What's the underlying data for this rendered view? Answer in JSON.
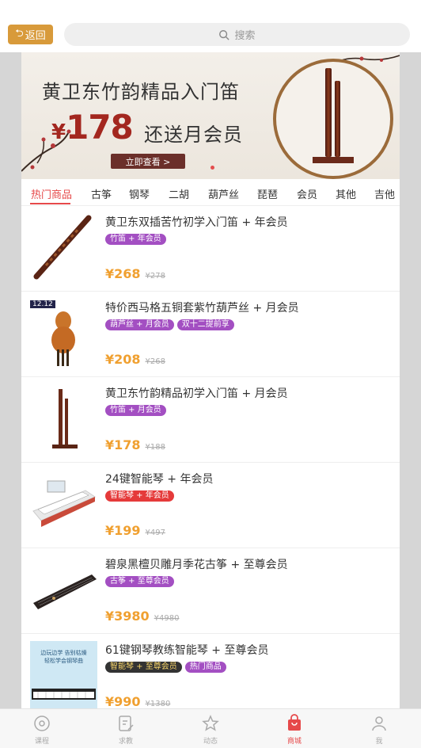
{
  "header": {
    "back_label": "返回",
    "search_placeholder": "搜索"
  },
  "banner": {
    "title": "黄卫东竹韵精品入门笛",
    "price_symbol": "¥",
    "price": "178",
    "subtitle": "还送月会员",
    "cta": "立即查看 >"
  },
  "tabs": [
    "热门商品",
    "古筝",
    "钢琴",
    "二胡",
    "葫芦丝",
    "琵琶",
    "会员",
    "其他",
    "吉他"
  ],
  "active_tab": "热门商品",
  "products": [
    {
      "name": "黄卫东双插苦竹初学入门笛 + 年会员",
      "tags": [
        {
          "text": "竹笛 + 年会员",
          "style": "purple"
        }
      ],
      "price": "¥268",
      "old_price": "¥278",
      "thumb_icon": "flute-icon"
    },
    {
      "name": "特价西马格五铜套紫竹葫芦丝 + 月会员",
      "tags": [
        {
          "text": "葫芦丝 + 月会员",
          "style": "purple"
        },
        {
          "text": "双十二提前享",
          "style": "purple"
        }
      ],
      "price": "¥208",
      "old_price": "¥268",
      "thumb_icon": "hulusi-icon",
      "thumb_badge": "12.12"
    },
    {
      "name": "黄卫东竹韵精品初学入门笛 + 月会员",
      "tags": [
        {
          "text": "竹笛 + 月会员",
          "style": "purple"
        }
      ],
      "price": "¥178",
      "old_price": "¥188",
      "thumb_icon": "flute-stand-icon"
    },
    {
      "name": "24键智能琴 + 年会员",
      "tags": [
        {
          "text": "智能琴 + 年会员",
          "style": "red"
        }
      ],
      "price": "¥199",
      "old_price": "¥497",
      "thumb_icon": "keyboard-icon"
    },
    {
      "name": "碧泉黑檀贝雕月季花古筝 + 至尊会员",
      "tags": [
        {
          "text": "古筝 + 至尊会员",
          "style": "purple"
        }
      ],
      "price": "¥3980",
      "old_price": "¥4980",
      "thumb_icon": "guzheng-icon"
    },
    {
      "name": "61键钢琴教练智能琴 + 至尊会员",
      "tags": [
        {
          "text": "智能琴 + 至尊会员",
          "style": "dark"
        },
        {
          "text": "热门商品",
          "style": "purple"
        }
      ],
      "price": "¥990",
      "old_price": "¥1380",
      "thumb_icon": "piano-61-icon",
      "thumb_caption": "边玩边学 告别枯燥\n轻松学会钢琴曲"
    }
  ],
  "bottom_nav": [
    {
      "label": "课程",
      "icon": "disc-icon"
    },
    {
      "label": "求教",
      "icon": "edit-icon"
    },
    {
      "label": "动态",
      "icon": "star-icon"
    },
    {
      "label": "商城",
      "icon": "bag-icon",
      "active": true
    },
    {
      "label": "我",
      "icon": "user-icon"
    }
  ],
  "colors": {
    "accent": "#e6494a",
    "back_button": "#d89a3a",
    "price": "#f0a030",
    "tag_purple": "#a34fc2",
    "tag_red": "#e53a3a",
    "banner_price": "#a3271f"
  }
}
